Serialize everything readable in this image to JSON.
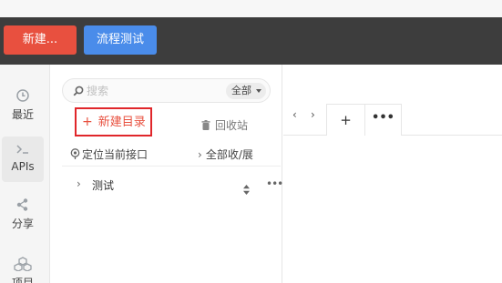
{
  "toolbar": {
    "new_label": "新建...",
    "flow_test_label": "流程测试"
  },
  "nav": {
    "items": [
      {
        "label": "最近",
        "icon": "clock-icon"
      },
      {
        "label": "APIs",
        "icon": "terminal-icon"
      },
      {
        "label": "分享",
        "icon": "share-icon"
      },
      {
        "label": "项目",
        "icon": "cubes-icon"
      }
    ]
  },
  "panel": {
    "search_placeholder": "搜索",
    "scope_label": "全部",
    "new_folder_label": "新建目录",
    "recycle_label": "回收站",
    "locate_label": "定位当前接口",
    "collapse_label": "全部收/展",
    "tree": [
      {
        "name": "测试"
      }
    ]
  },
  "tabs": {
    "add_label": "+",
    "more_label": "•••"
  },
  "colors": {
    "toolbar_bg": "#3d3d3d",
    "new_button": "#e8503f",
    "flow_button": "#4a8cea",
    "highlight_border": "#e0262a"
  }
}
